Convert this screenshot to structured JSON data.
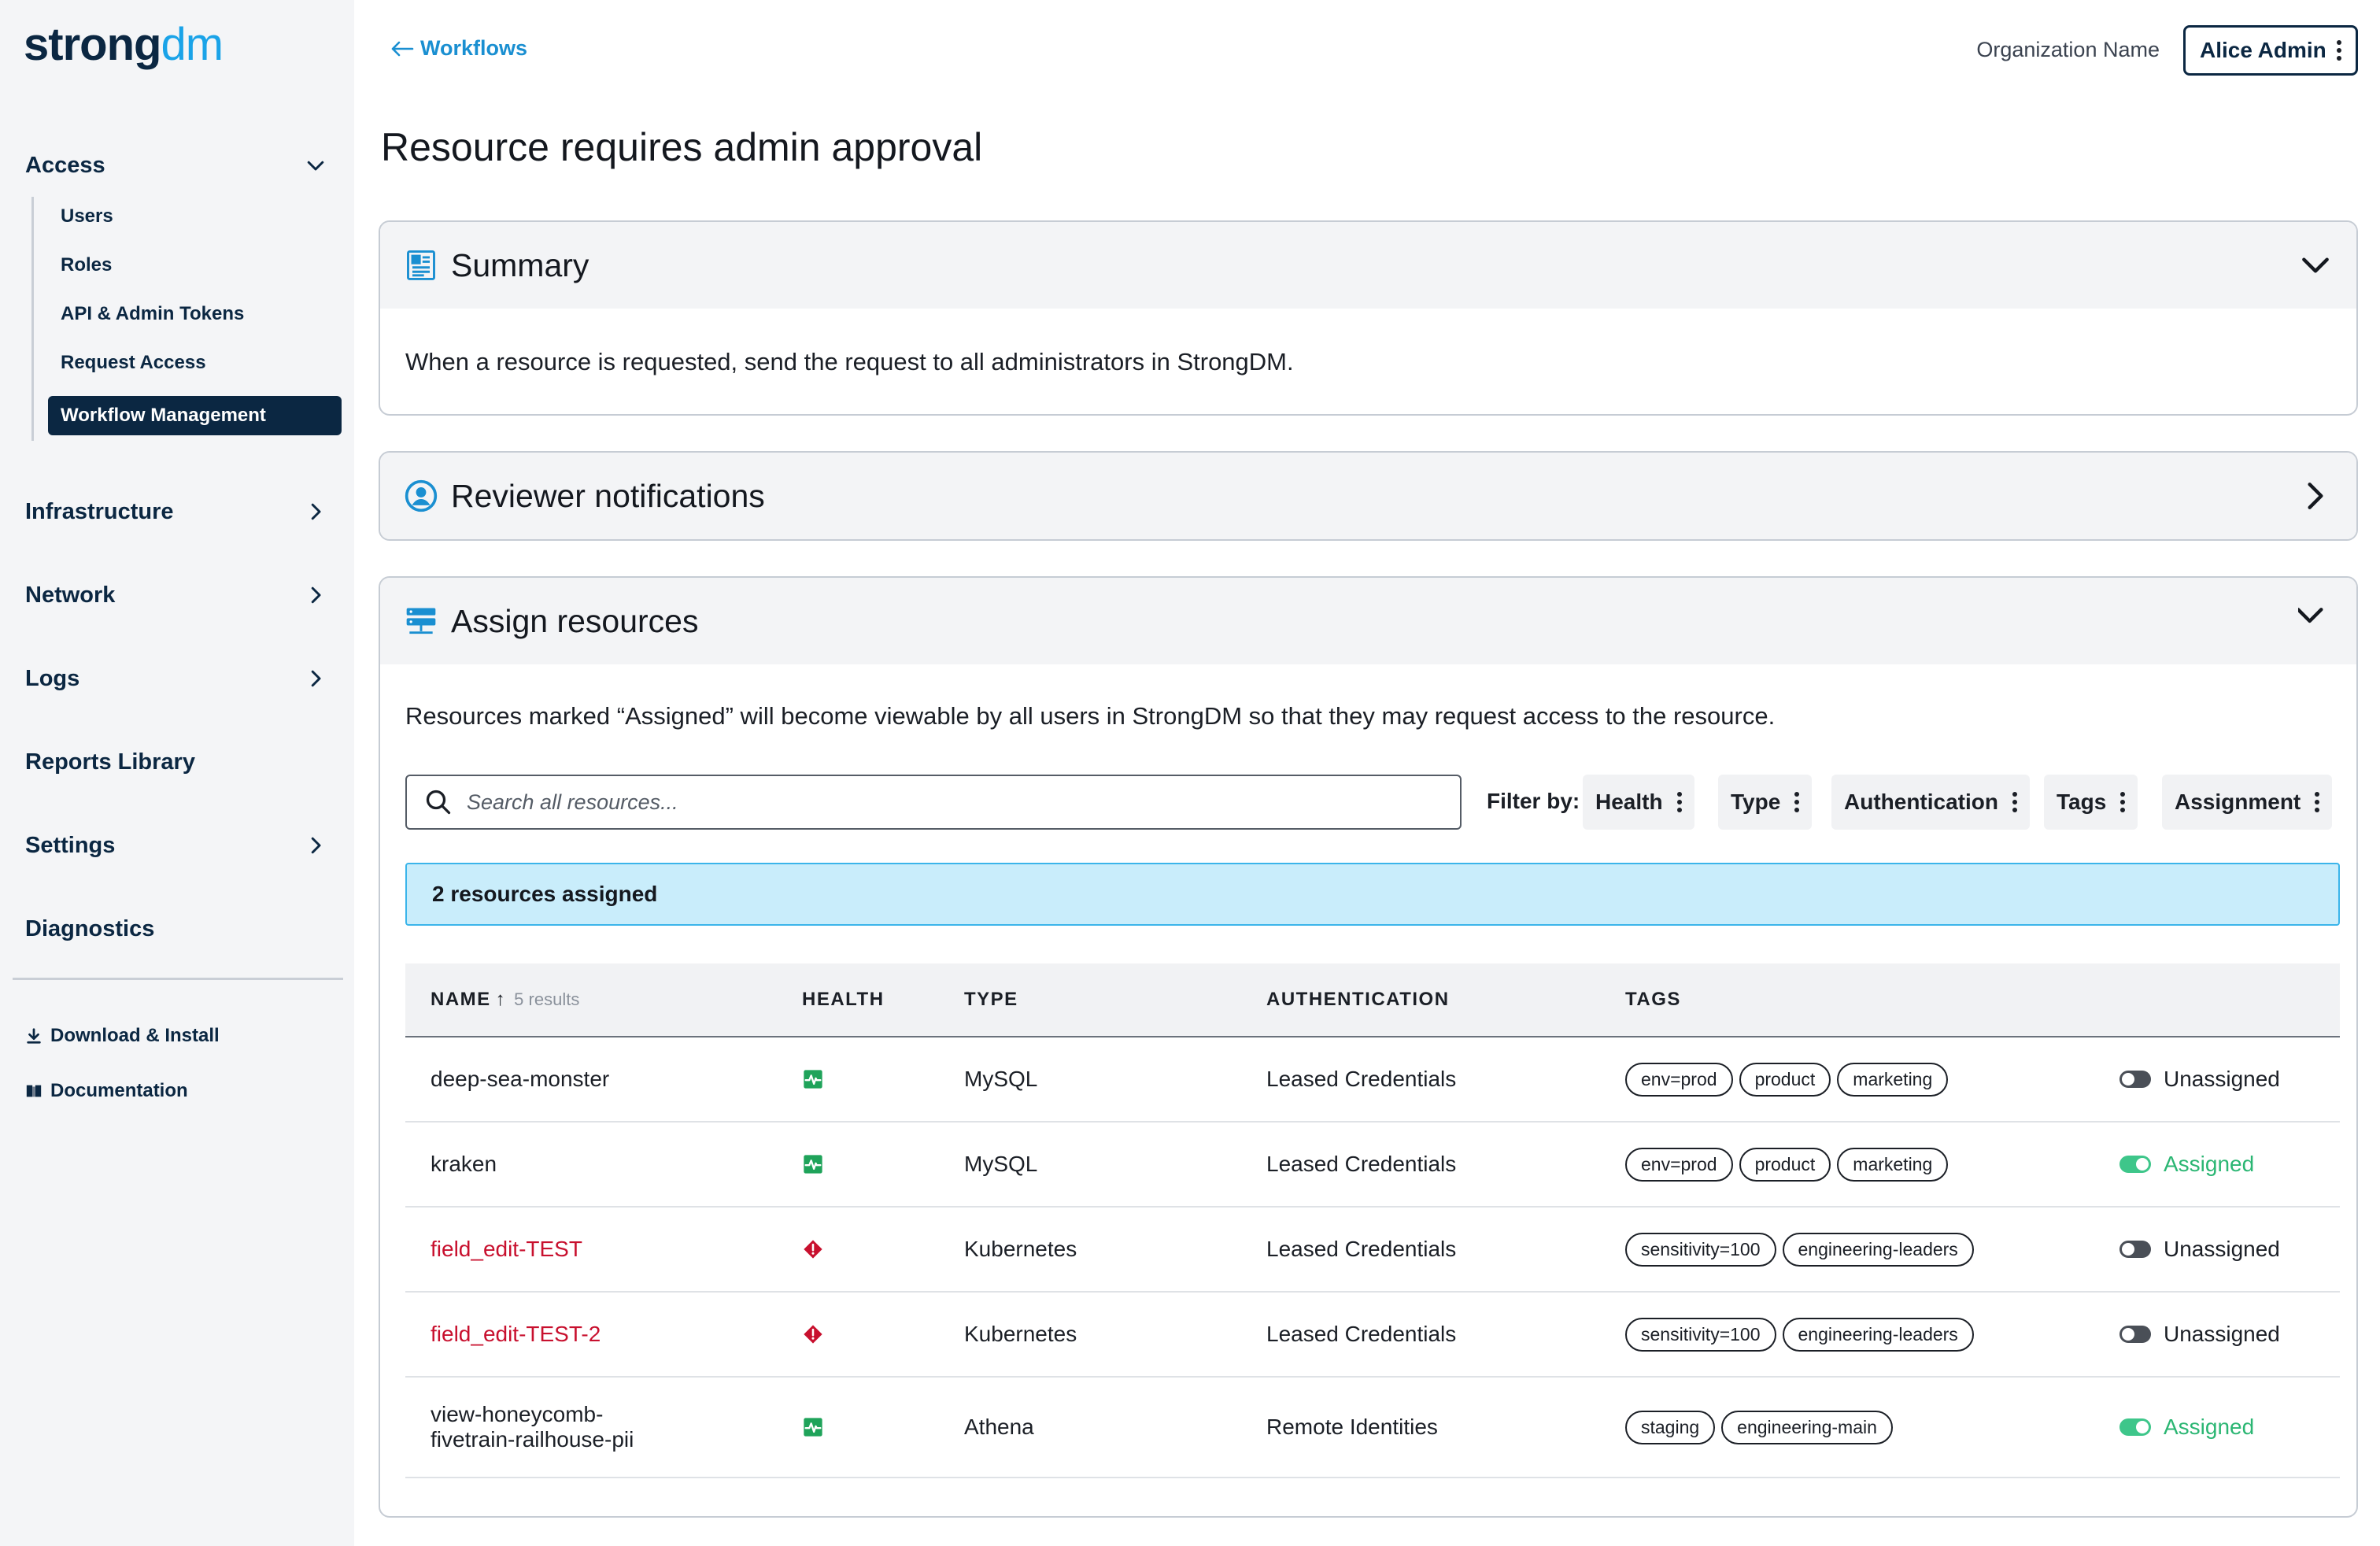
{
  "brand": {
    "logo_main": "strong",
    "logo_accent": "dm"
  },
  "sidebar": {
    "access": {
      "label": "Access"
    },
    "access_items": [
      {
        "label": "Users"
      },
      {
        "label": "Roles"
      },
      {
        "label": "API & Admin Tokens"
      },
      {
        "label": "Request Access"
      },
      {
        "label": "Workflow Management",
        "active": true
      }
    ],
    "sections": [
      {
        "label": "Infrastructure",
        "has_arrow": true
      },
      {
        "label": "Network",
        "has_arrow": true
      },
      {
        "label": "Logs",
        "has_arrow": true
      },
      {
        "label": "Reports Library",
        "has_arrow": false
      },
      {
        "label": "Settings",
        "has_arrow": true
      },
      {
        "label": "Diagnostics",
        "has_arrow": false
      }
    ],
    "download": {
      "label": "Download & Install",
      "icon": "download-icon"
    },
    "docs": {
      "label": "Documentation",
      "icon": "book-icon"
    }
  },
  "header": {
    "back_label": "Workflows",
    "org_name": "Organization Name",
    "user_name": "Alice Admin"
  },
  "page": {
    "title": "Resource requires admin approval"
  },
  "summary": {
    "title": "Summary",
    "text": "When a resource is requested, send the request to all administrators in StrongDM.",
    "expanded": true
  },
  "reviewer": {
    "title": "Reviewer notifications",
    "expanded": false
  },
  "assign": {
    "title": "Assign resources",
    "description": "Resources marked “Assigned” will become viewable by all users in StrongDM so that they may request access to the resource.",
    "search_placeholder": "Search all resources...",
    "filter_label": "Filter by:",
    "filters": [
      "Health",
      "Type",
      "Authentication",
      "Tags",
      "Assignment"
    ],
    "banner": "2 resources assigned",
    "table": {
      "headers": {
        "name": "NAME",
        "name_sort": "↑",
        "results": "5 results",
        "health": "HEALTH",
        "type": "TYPE",
        "auth": "AUTHENTICATION",
        "tags": "TAGS"
      },
      "rows": [
        {
          "name": "deep-sea-monster",
          "health": "healthy",
          "type": "MySQL",
          "auth": "Leased Credentials",
          "tags": [
            "env=prod",
            "product",
            "marketing"
          ],
          "assigned": false,
          "assignment": "Unassigned"
        },
        {
          "name": "kraken",
          "health": "healthy",
          "type": "MySQL",
          "auth": "Leased Credentials",
          "tags": [
            "env=prod",
            "product",
            "marketing"
          ],
          "assigned": true,
          "assignment": "Assigned"
        },
        {
          "name": "field_edit-TEST",
          "health": "unhealthy",
          "type": "Kubernetes",
          "auth": "Leased Credentials",
          "tags": [
            "sensitivity=100",
            "engineering-leaders"
          ],
          "assigned": false,
          "assignment": "Unassigned"
        },
        {
          "name": "field_edit-TEST-2",
          "health": "unhealthy",
          "type": "Kubernetes",
          "auth": "Leased Credentials",
          "tags": [
            "sensitivity=100",
            "engineering-leaders"
          ],
          "assigned": false,
          "assignment": "Unassigned"
        },
        {
          "name": "view-honeycomb-fivetrain-railhouse-pii",
          "health": "healthy",
          "type": "Athena",
          "auth": "Remote Identities",
          "tags": [
            "staging",
            "engineering-main"
          ],
          "assigned": true,
          "assignment": "Assigned"
        }
      ]
    }
  },
  "colors": {
    "navy": "#0b2742",
    "accent_blue": "#1aa3e8",
    "link": "#1a8fd1",
    "healthy": "#1fa35a",
    "unhealthy": "#c8102e",
    "assigned": "#2bb673",
    "banner_bg": "#c9edfb"
  }
}
